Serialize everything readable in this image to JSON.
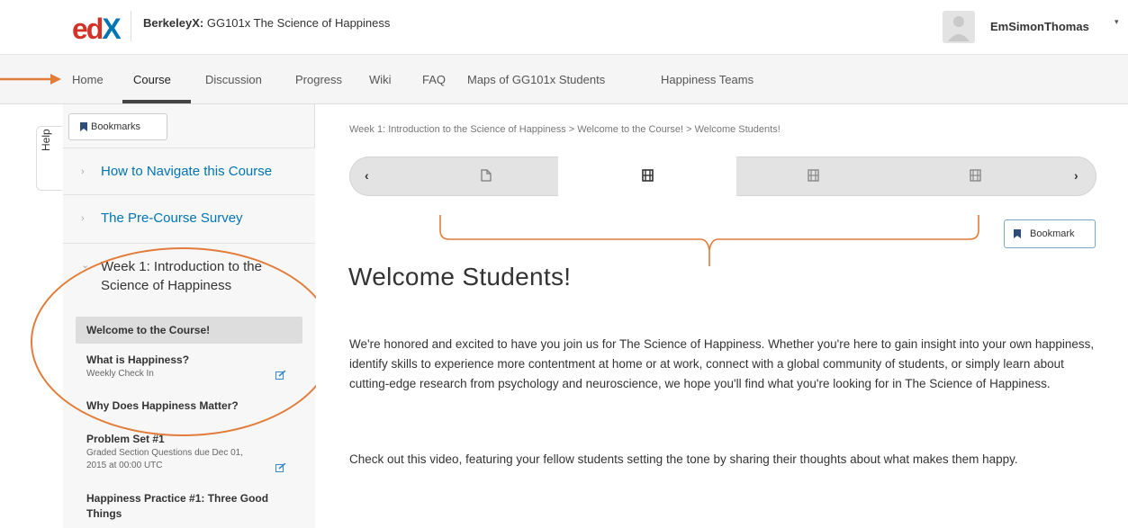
{
  "header": {
    "logo_ed": "ed",
    "logo_x": "X",
    "course_prefix": "BerkeleyX:",
    "course_name": "GG101x The Science of Happiness",
    "username": "EmSimonThomas",
    "user_caret": "▾"
  },
  "nav": {
    "items": [
      "Home",
      "Course",
      "Discussion",
      "Progress",
      "Wiki",
      "FAQ",
      "Maps of GG101x Students",
      "Happiness Teams"
    ],
    "active": "Course"
  },
  "help": {
    "label": "Help"
  },
  "sidebar": {
    "bookmarks_label": "Bookmarks",
    "sections": [
      {
        "chevron": "›",
        "label": "How to Navigate this Course"
      },
      {
        "chevron": "›",
        "label": "The Pre-Course Survey"
      }
    ],
    "week": {
      "chevron": "⌄",
      "title": "Week 1: Introduction to the Science of Happiness"
    },
    "subsections": [
      {
        "label": "Welcome to the Course!",
        "meta": ""
      },
      {
        "label": "What is Happiness?",
        "meta": "Weekly Check In"
      },
      {
        "label": "Why Does Happiness Matter?",
        "meta": ""
      },
      {
        "label": "Problem Set #1",
        "meta": "Graded Section Questions due Dec 01, 2015 at 00:00 UTC"
      },
      {
        "label": "Happiness Practice #1: Three Good Things",
        "meta": ""
      }
    ]
  },
  "main": {
    "breadcrumb": "Week 1: Introduction to the Science of Happiness > Welcome to the Course! > Welcome Students!",
    "sequence": {
      "prev": "‹",
      "next": "›",
      "items": [
        {
          "icon": "document-icon"
        },
        {
          "icon": "video-icon"
        },
        {
          "icon": "video-icon"
        },
        {
          "icon": "video-icon"
        }
      ],
      "active_index": 1
    },
    "bookmark_label": "Bookmark",
    "title": "Welcome Students!",
    "paragraphs": [
      "We're honored and excited to have you join us for The Science of Happiness. Whether you're here to gain insight into your own happiness, identify skills to experience more contentment at home or at work, connect with a global community of students, or simply learn about cutting-edge research from psychology and neuroscience, we hope you'll find what you're looking for in The Science of Happiness.",
      "Check out this video, featuring your fellow students setting the tone by sharing their thoughts about what makes them happy."
    ]
  },
  "colors": {
    "annotation_orange": "#e27c3a",
    "link_blue": "#0075b4",
    "edx_red": "#d23228"
  }
}
